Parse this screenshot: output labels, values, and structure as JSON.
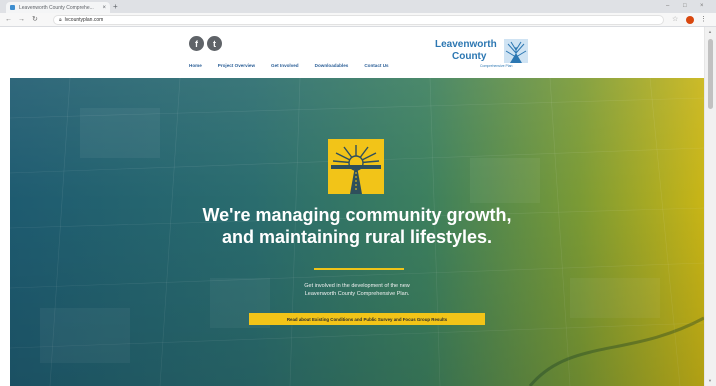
{
  "browser": {
    "tab_title": "Leavenworth County Comprehe...",
    "tab_close": "×",
    "new_tab": "+",
    "url": "lvcountyplan.com",
    "window_controls": [
      "–",
      "□",
      "×"
    ],
    "profile_color": "#d9480f"
  },
  "header": {
    "social": [
      {
        "icon": "facebook-icon",
        "glyph": "f"
      },
      {
        "icon": "twitter-icon",
        "glyph": "t"
      }
    ],
    "nav": [
      "Home",
      "Project Overview",
      "Get Involved",
      "Downloadables",
      "Contact Us"
    ],
    "logo": {
      "line1": "Leavenworth",
      "line2": "County",
      "tagline": "Comprehensive Plan"
    }
  },
  "hero": {
    "headline_line1": "We're managing community growth,",
    "headline_line2": "and maintaining rural lifestyles.",
    "sub_line1": "Get involved in the development of the new",
    "sub_line2": "Leavenworth County Comprehensive Plan.",
    "cta_label": "Read about Existing Conditions and Public Survey and Focus Group Results"
  },
  "colors": {
    "brand_blue": "#2c77b2",
    "nav_blue": "#2b5f97",
    "accent_yellow": "#f2c418",
    "hero_teal": "#1e5b70",
    "hero_gold": "#c9b516"
  }
}
